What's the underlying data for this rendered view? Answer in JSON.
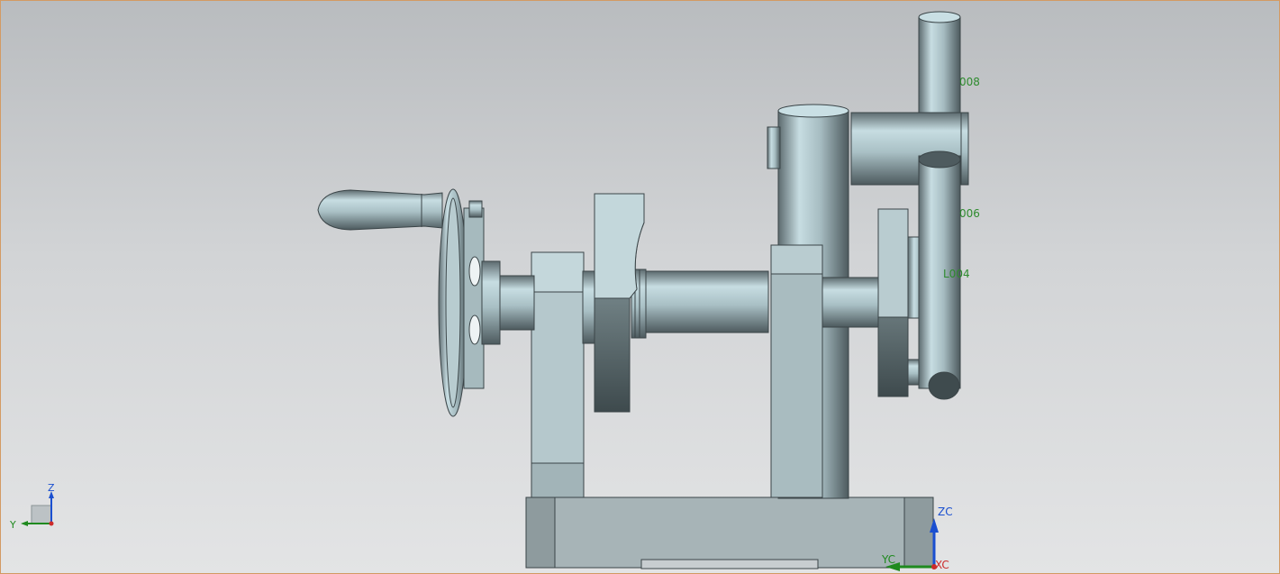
{
  "viewport": {
    "accent_border": "#d39a63",
    "background_top": "#b9bcbf",
    "background_bottom": "#e3e4e5"
  },
  "annotations": [
    "008",
    "006",
    "L004"
  ],
  "annotation_color": "#2e8b2e",
  "wcs": {
    "zc": "ZC",
    "yc": "YC",
    "xc": "XC"
  },
  "triad": {
    "z": "Z",
    "y": "Y"
  },
  "axis_colors": {
    "z": "#1a4fd0",
    "y": "#1f8a1f",
    "x": "#cc2b2b"
  }
}
